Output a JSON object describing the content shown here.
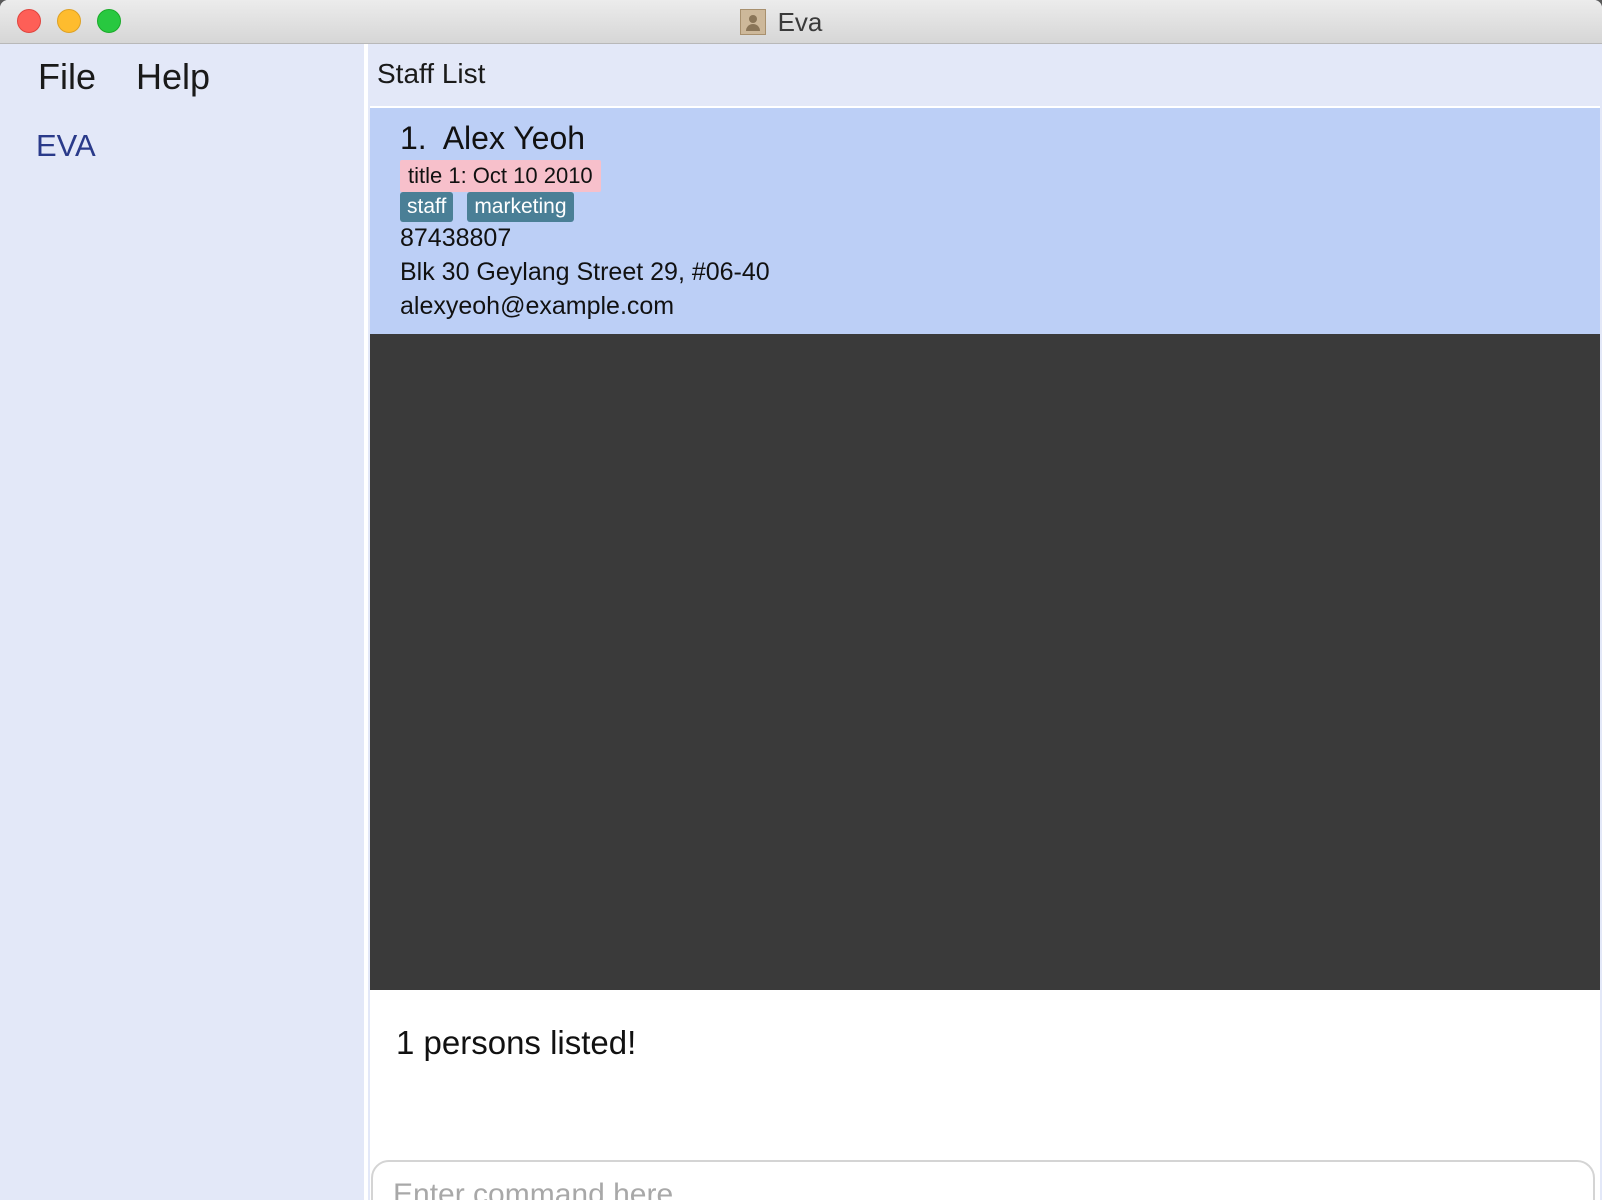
{
  "window": {
    "title": "Eva"
  },
  "menu": {
    "items": [
      {
        "label": "File"
      },
      {
        "label": "Help"
      }
    ]
  },
  "sidebar": {
    "brand": "EVA"
  },
  "panel": {
    "title": "Staff List"
  },
  "staff": [
    {
      "index": "1.",
      "name": "Alex Yeoh",
      "title_tag": "title 1: Oct 10 2010",
      "tags": [
        "staff",
        "marketing"
      ],
      "phone": "87438807",
      "address": "Blk 30 Geylang Street 29, #06-40",
      "email": "alexyeoh@example.com"
    }
  ],
  "result": {
    "message": "1 persons listed!"
  },
  "command": {
    "placeholder": "Enter command here...",
    "value": ""
  },
  "colors": {
    "sidebar_bg": "#e3e8f8",
    "card_selected_bg": "#bccff6",
    "title_tag_bg": "#f7c0cb",
    "tag_bg": "#4a7f96",
    "list_bg": "#3a3a3a",
    "brand_text": "#2a3a8a"
  }
}
